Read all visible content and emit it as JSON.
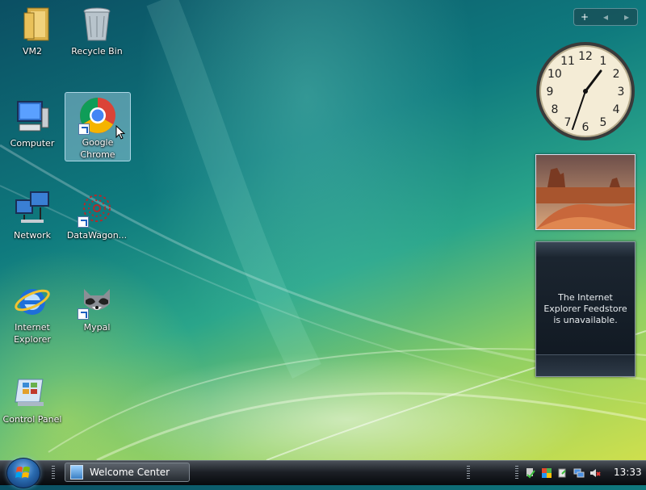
{
  "desktop": {
    "icons": [
      {
        "label": "VM2"
      },
      {
        "label": "Recycle Bin"
      },
      {
        "label": "Computer"
      },
      {
        "label": "Google Chrome"
      },
      {
        "label": "Network"
      },
      {
        "label": "DataWagon..."
      },
      {
        "label": "Internet Explorer"
      },
      {
        "label": "Mypal"
      },
      {
        "label": "Control Panel"
      }
    ]
  },
  "sidebar": {
    "controls": {
      "add": "+",
      "prev": "◂",
      "next": "▸"
    },
    "clock": {
      "numerals": [
        "12",
        "1",
        "2",
        "3",
        "4",
        "5",
        "6",
        "7",
        "8",
        "9",
        "10",
        "11"
      ]
    },
    "feed": {
      "message": "The Internet Explorer Feedstore is unavailable."
    }
  },
  "taskbar": {
    "tasks": [
      {
        "label": "Welcome Center"
      }
    ],
    "clock_time": "13:33"
  },
  "colors": {
    "accent": "#1d5fbf",
    "selection": "#aad7eb"
  }
}
